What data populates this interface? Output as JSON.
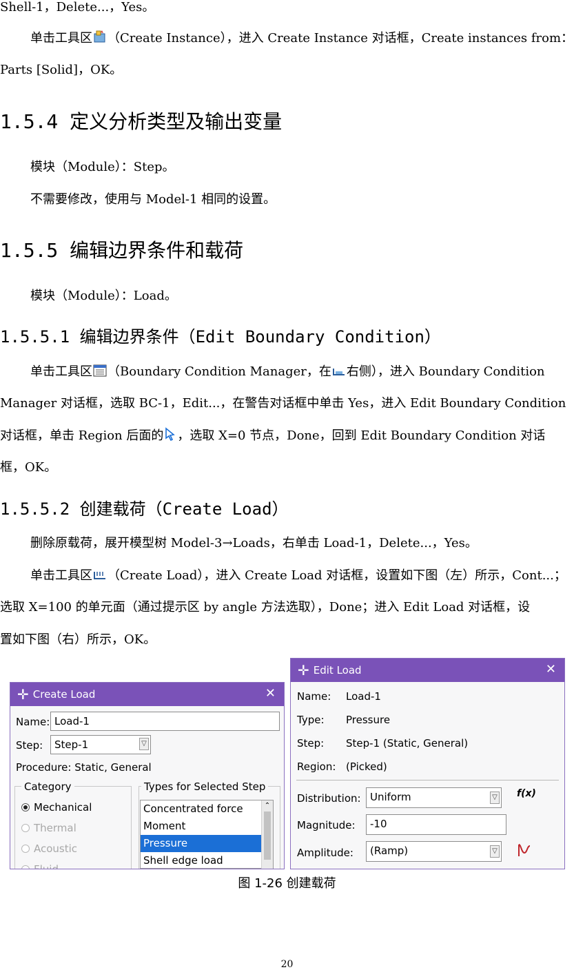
{
  "lines": {
    "l0": "Shell-1，Delete...，Yes。",
    "l1a": "单击工具区",
    "l1b": "（Create Instance），进入 Create Instance 对话框，Create instances from：",
    "l2": "Parts [Solid]，OK。",
    "l5": "模块（Module）：Step。",
    "l6": "不需要修改，使用与 Model-1 相同的设置。",
    "l8": "模块（Module）：Load。",
    "l10a": "单击工具区",
    "l10b": "（Boundary Condition Manager，在",
    "l10c": "右侧），进入 Boundary Condition",
    "l11": "Manager 对话框，选取 BC-1，Edit...，在警告对话框中单击 Yes，进入 Edit Boundary Condition",
    "l12a": "对话框，单击 Region 后面的",
    "l12b": "，选取 X=0 节点，Done，回到 Edit Boundary Condition 对话",
    "l13": "框，OK。",
    "l15": "删除原载荷，展开模型树 Model-3→Loads，右单击 Load-1，Delete...，Yes。",
    "l16a": "单击工具区",
    "l16b": "（Create Load），进入 Create Load 对话框，设置如下图（左）所示，Cont...；",
    "l17": "选取 X=100 的单元面（通过提示区 by angle 方法选取），Done；进入 Edit Load 对话框，设",
    "l18": "置如下图（右）所示，OK。"
  },
  "headings": {
    "h154": "1.5.4 定义分析类型及输出变量",
    "h155": "1.5.5 编辑边界条件和载荷",
    "h1551": "1.5.5.1 编辑边界条件（Edit Boundary Condition）",
    "h1552": "1.5.5.2 创建载荷（Create Load）"
  },
  "create_load": {
    "title": "Create Load",
    "name_label": "Name:",
    "name_value": "Load-1",
    "step_label": "Step:",
    "step_value": "Step-1",
    "procedure": "Procedure:  Static, General",
    "category_label": "Category",
    "categories": [
      "Mechanical",
      "Thermal",
      "Acoustic",
      "Fluid"
    ],
    "types_label": "Types for Selected Step",
    "types": [
      "Concentrated force",
      "Moment",
      "Pressure",
      "Shell edge load"
    ]
  },
  "edit_load": {
    "title": "Edit Load",
    "name_label": "Name:",
    "name_value": "Load-1",
    "type_label": "Type:",
    "type_value": "Pressure",
    "step_label": "Step:",
    "step_value": "Step-1 (Static, General)",
    "region_label": "Region:",
    "region_value": "(Picked)",
    "distribution_label": "Distribution:",
    "distribution_value": "Uniform",
    "fx_label": "f(x)",
    "magnitude_label": "Magnitude:",
    "magnitude_value": "-10",
    "amplitude_label": "Amplitude:",
    "amplitude_value": "(Ramp)"
  },
  "caption": "图 1-26  创建载荷",
  "page_number": "20",
  "colors": {
    "dialog_title": "#7a52b8",
    "selection": "#1b6fd6",
    "amplitude_icon": "#c0272d"
  }
}
